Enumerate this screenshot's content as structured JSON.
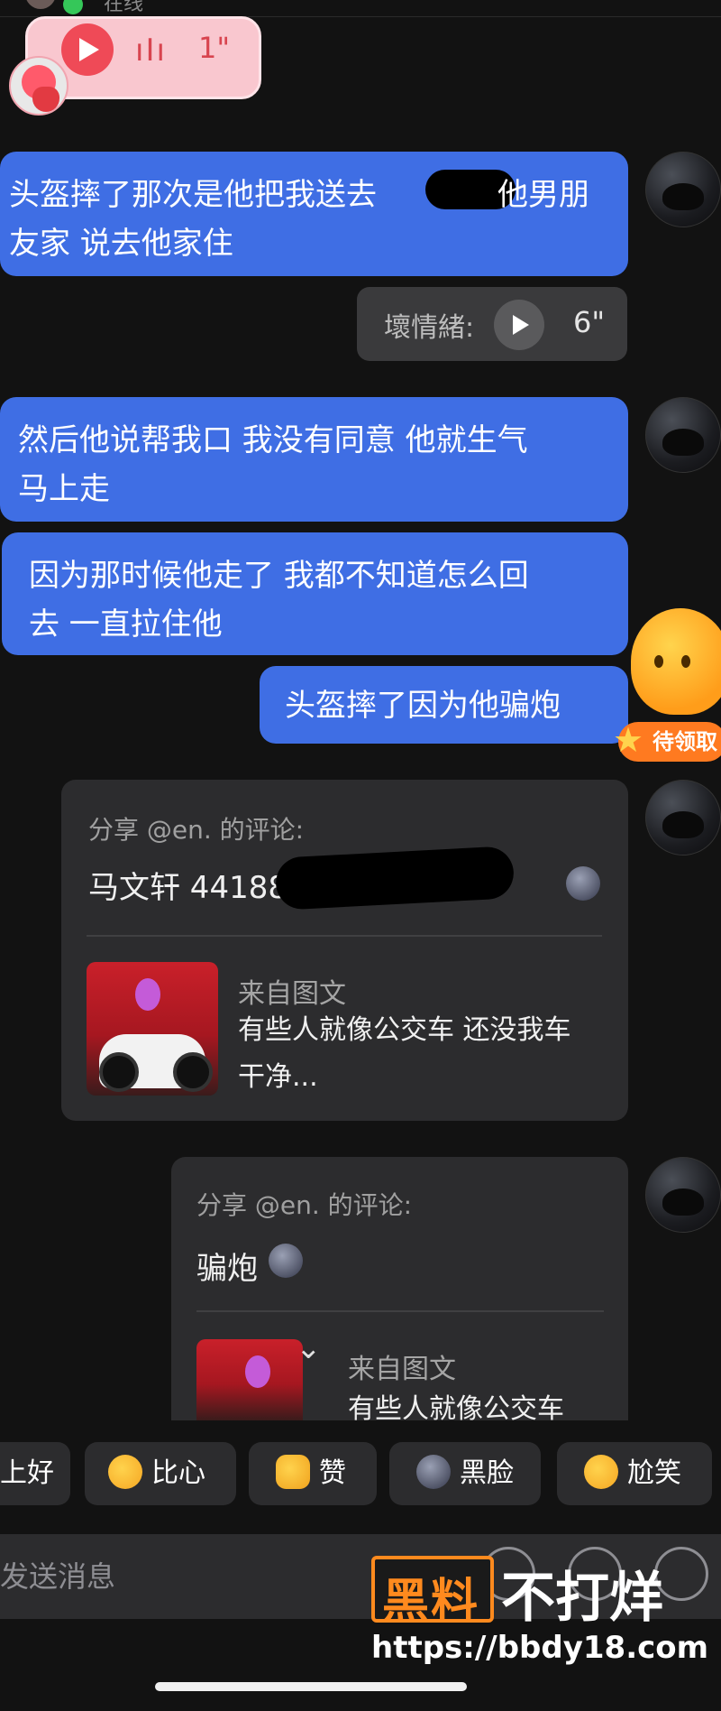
{
  "header": {
    "status": "在线"
  },
  "voice_received": {
    "duration": "1\""
  },
  "messages": {
    "m1_line1": "头盔摔了那次是他把我送去",
    "m1_line1_end": "他男朋",
    "m1_line2": "友家 说去他家住",
    "voice_sent": {
      "label": "壞情緒:",
      "duration": "6\""
    },
    "m2_line1": "然后他说帮我口 我没有同意 他就生气",
    "m2_line2": "马上走",
    "m3_line1": "因为那时候他走了 我都不知道怎么回",
    "m3_line2": "去 一直拉住他",
    "m4": "头盔摔了因为他骗炮"
  },
  "mascot_badge": "待领取",
  "share1": {
    "header": "分享 @en. 的评论:",
    "comment": "马文轩 44188",
    "source_label": "来自图文",
    "title_line1": "有些人就像公交车 还没我车",
    "title_line2": "干净..."
  },
  "share2": {
    "header": "分享 @en. 的评论:",
    "comment": "骗炮",
    "source_label": "来自图文",
    "title_line1": "有些人就像公交车"
  },
  "reactions": [
    {
      "label": "上好"
    },
    {
      "label": "比心",
      "icon": "heart-hands-emoji-icon"
    },
    {
      "label": "赞",
      "icon": "thumbs-up-icon"
    },
    {
      "label": "黑脸",
      "icon": "dark-face-icon"
    },
    {
      "label": "尬笑",
      "icon": "grin-sweat-icon"
    }
  ],
  "input": {
    "placeholder": "发送消息"
  },
  "watermark": {
    "box_text": "黑料",
    "text": "不打烊",
    "url": "https://bbdy18.com"
  },
  "colors": {
    "bubble_blue": "#3f6ee4",
    "background": "#121212",
    "card": "#2c2c2e",
    "accent_orange": "#ff8a1e"
  }
}
